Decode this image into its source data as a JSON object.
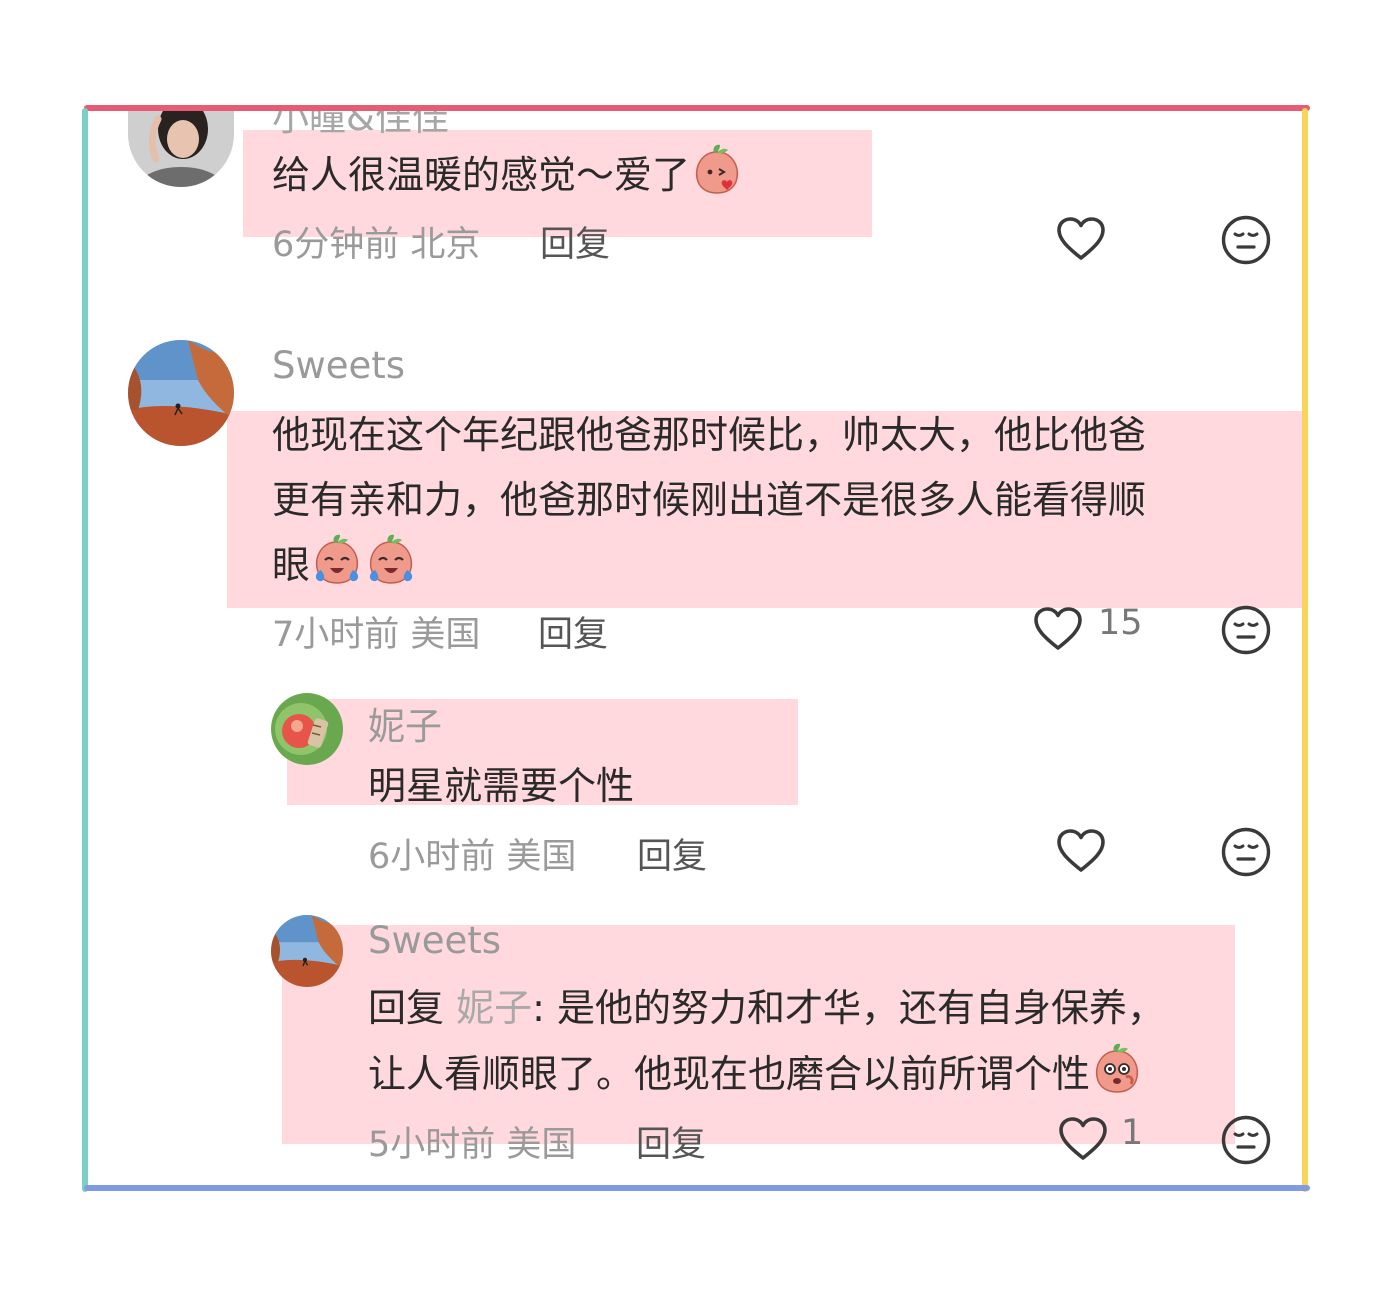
{
  "comments": [
    {
      "username": "小瞳&佳佳",
      "text": "给人很温暖的感觉～爱了",
      "emoji": "peach-kiss-emoji",
      "time": "6分钟前",
      "location": "北京",
      "reply_label": "回复",
      "likes": ""
    },
    {
      "username": "Sweets",
      "text_line1": "他现在这个年纪跟他爸那时候比，帅太大，他比他爸",
      "text_line2": "更有亲和力，他爸那时候刚出道不是很多人能看得顺",
      "text_line3": "眼",
      "emoji": "peach-crying-laugh-emoji",
      "time": "7小时前",
      "location": "美国",
      "reply_label": "回复",
      "likes": "15"
    }
  ],
  "replies": [
    {
      "username": "妮子",
      "text": "明星就需要个性",
      "time": "6小时前",
      "location": "美国",
      "reply_label": "回复",
      "likes": ""
    },
    {
      "username": "Sweets",
      "reply_prefix": "回复",
      "reply_target": "妮子",
      "text_line1": ": 是他的努力和才华，还有自身保养，",
      "text_line2": "让人看顺眼了。他现在也磨合以前所谓个性",
      "emoji": "peach-shy-emoji",
      "time": "5小时前",
      "location": "美国",
      "reply_label": "回复",
      "likes": "1"
    }
  ],
  "icons": {
    "like": "heart-outline-icon",
    "dislike": "neutral-face-icon"
  },
  "colors": {
    "highlight": "#ffbec4",
    "frame_top": "#e85b74",
    "frame_left": "#7ccfc8",
    "frame_right": "#fad45a",
    "frame_bottom": "#7f9be3"
  }
}
